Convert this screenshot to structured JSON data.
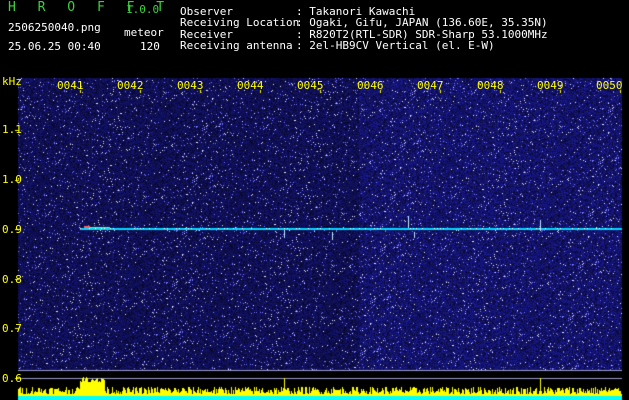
{
  "app": {
    "name": "H R O F F T",
    "version": "1.0.0"
  },
  "file": {
    "name": "2506250040.png",
    "datetime": "25.06.25 00:40",
    "type_label": "meteor",
    "count": "120"
  },
  "info": {
    "labels": [
      "Observer",
      "Receiving Location",
      "Receiver",
      "Receiving antenna"
    ],
    "values": [
      ": Takanori Kawachi",
      ": Ogaki, Gifu, JAPAN (136.60E, 35.35N)",
      ": R820T2(RTL-SDR) SDR-Sharp 53.1000MHz",
      ": 2el-HB9CV Vertical (el. E-W)"
    ]
  },
  "axes": {
    "y_unit": "kHz",
    "x_ticks": [
      "0041",
      "0042",
      "0043",
      "0044",
      "0045",
      "0046",
      "0047",
      "0048",
      "0049",
      "0050"
    ],
    "y_ticks": [
      "1.1",
      "1.0",
      "0.9",
      "0.8",
      "0.7",
      "0.6"
    ]
  },
  "colors": {
    "background": "#000000",
    "noise": "#1a1a8a",
    "carrier": "#00e0ff",
    "text_yellow": "#ffff00",
    "text_green": "#3bd13b",
    "bars": "#ffff00",
    "baseline": "#00ffff"
  }
}
